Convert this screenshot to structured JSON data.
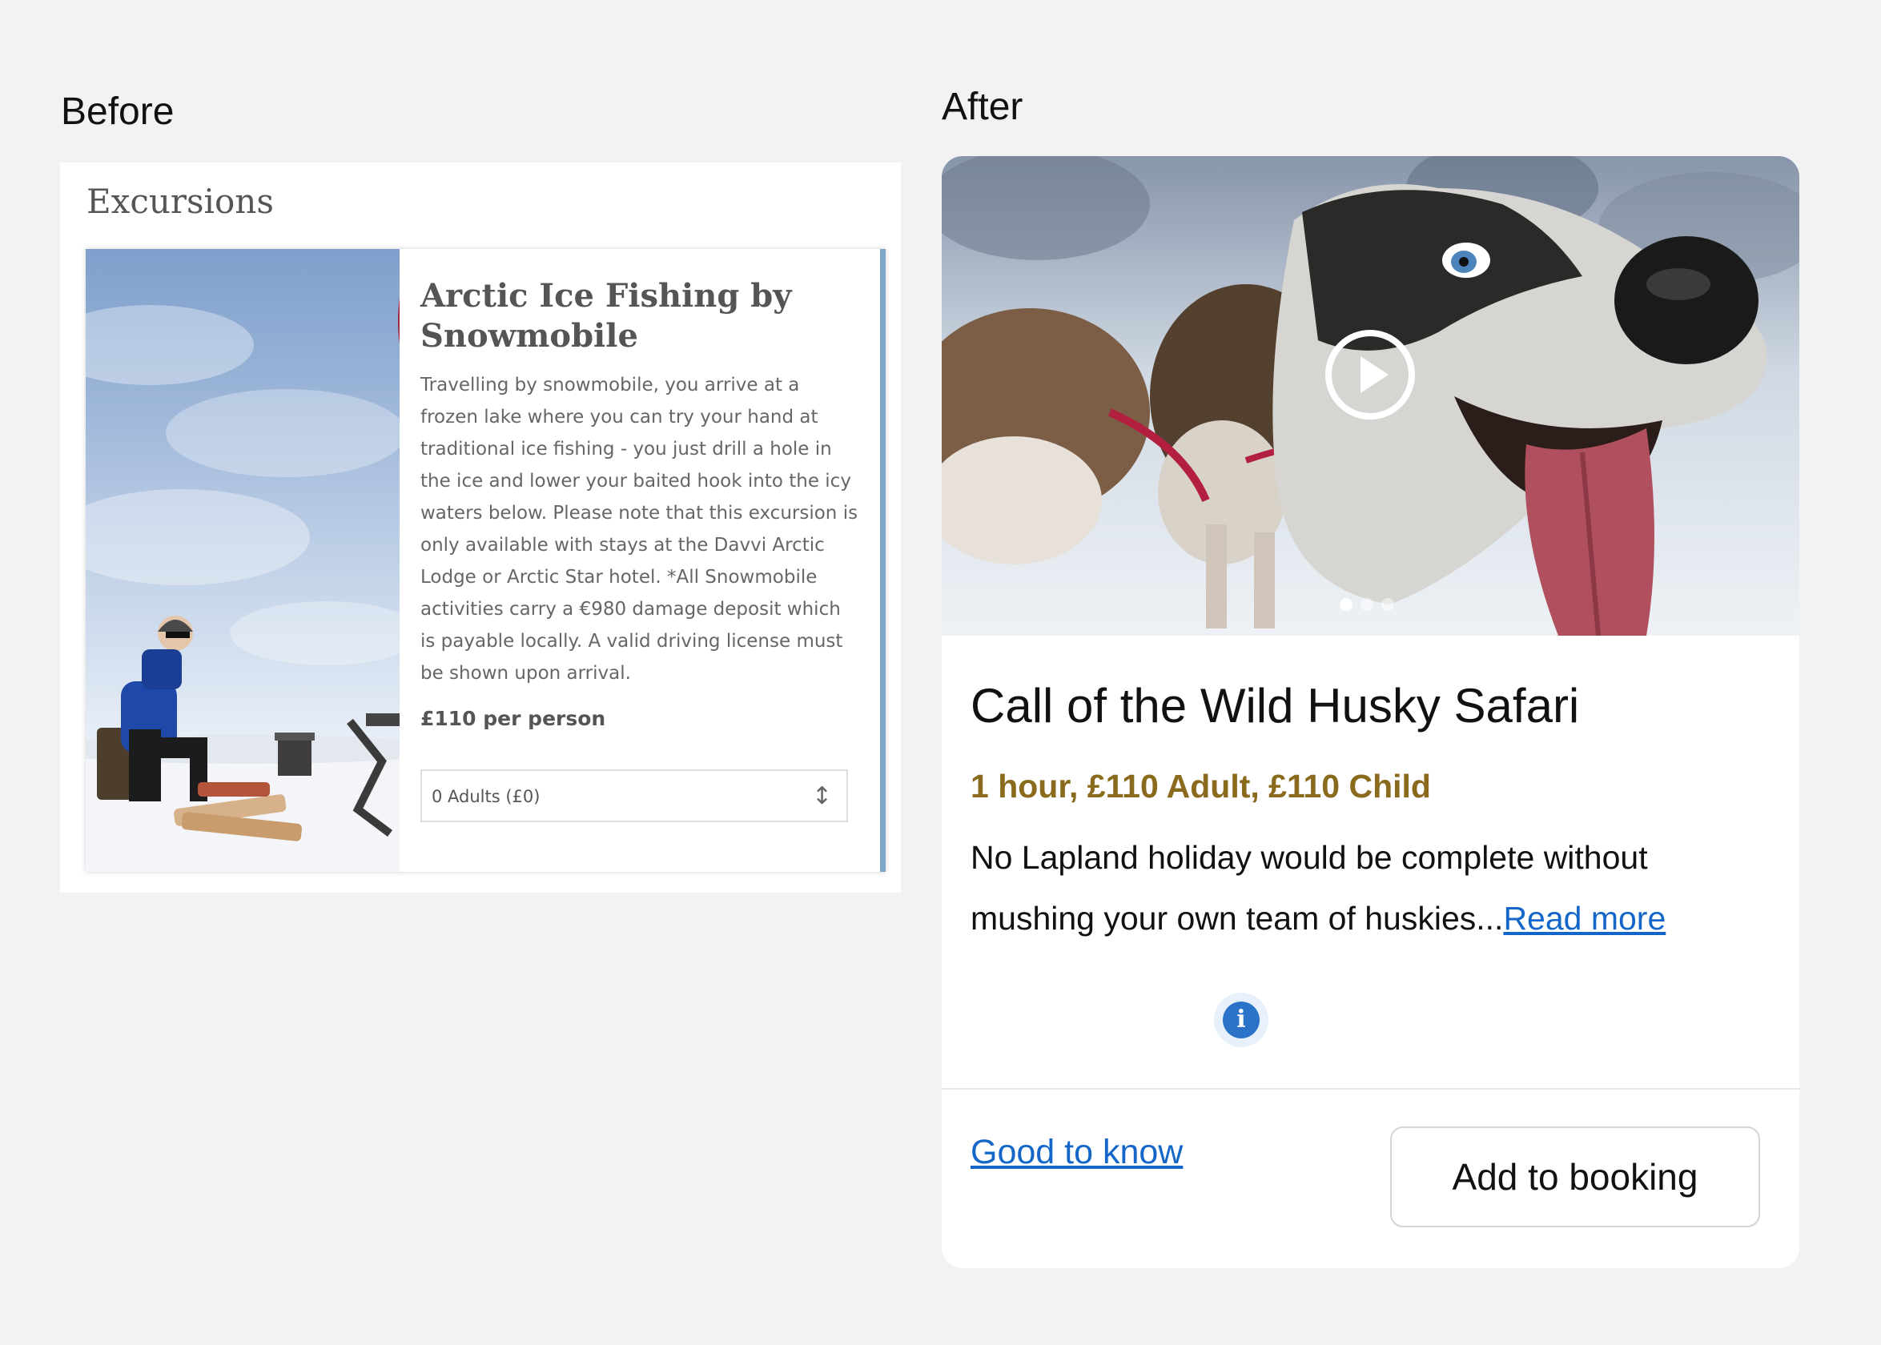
{
  "labels": {
    "before": "Before",
    "after": "After"
  },
  "before_panel": {
    "heading": "Excursions",
    "card": {
      "title": "Arctic Ice Fishing by Snowmobile",
      "description": "Travelling by snowmobile, you arrive at a frozen lake where you can try your hand at traditional ice fishing - you just drill a hole in the ice and lower your baited hook into the icy waters below. Please note that this excursion is only available with stays at the Davvi Arctic Lodge or Arctic Star hotel. *All Snowmobile activities carry a €980 damage deposit which is payable locally. A valid driving license must be shown upon arrival.",
      "price": "£110 per person",
      "quantity_select": {
        "value": "0 Adults (£0)",
        "icon": "updown-arrow-icon"
      },
      "accent_color": "#7ea6c8"
    }
  },
  "after_card": {
    "title": "Call of the Wild Husky Safari",
    "meta": "1 hour, £110 Adult, £110 Child",
    "meta_color": "#8a6b1e",
    "description": "No Lapland holiday would be complete without mushing your own team of huskies...",
    "read_more": "Read more",
    "good_to_know": "Good to know",
    "info_icon": "i",
    "link_color": "#1466c8",
    "add_button": "Add to booking",
    "media": {
      "play_icon": "play-icon",
      "slides_total": 3,
      "active_slide": 1
    }
  },
  "colors": {
    "page_background": "#f2f2f2",
    "card_background": "#ffffff"
  }
}
